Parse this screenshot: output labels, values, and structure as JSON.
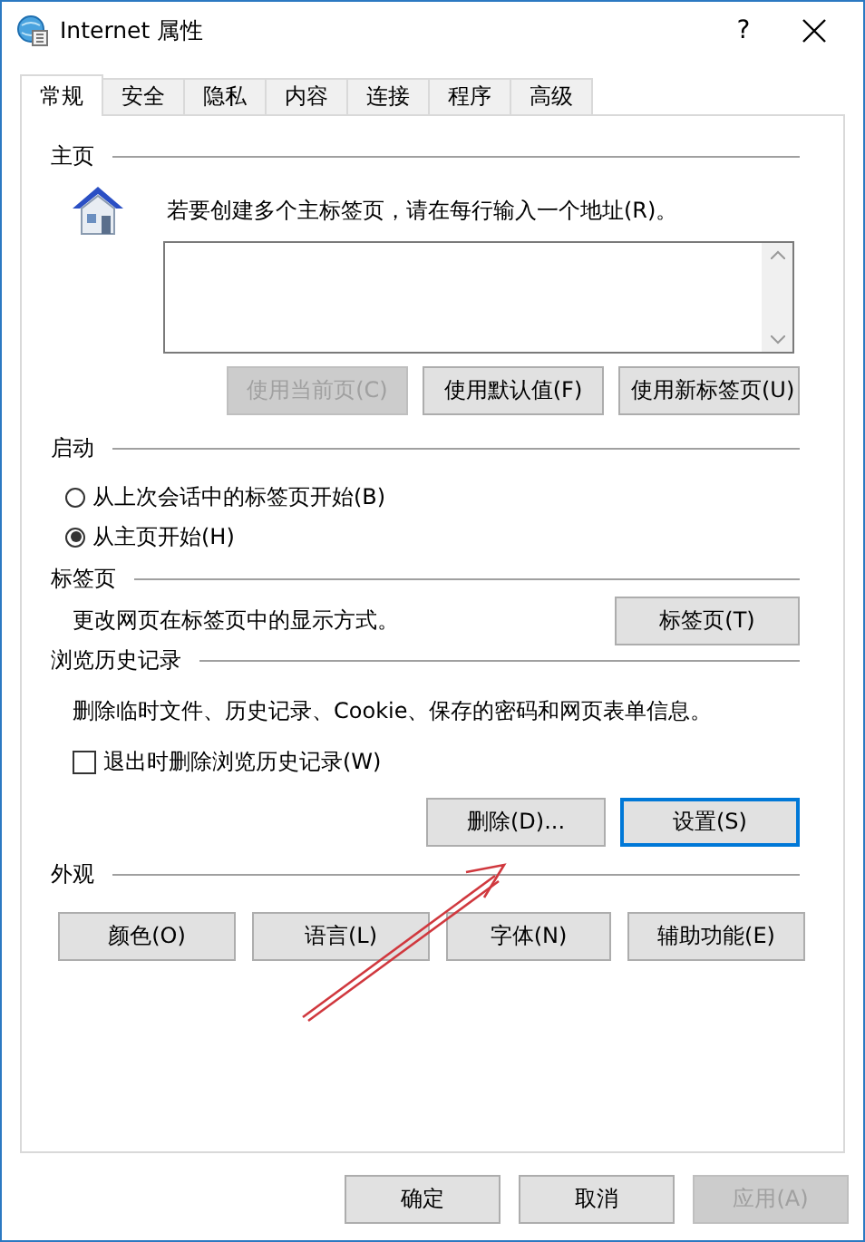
{
  "window": {
    "title": "Internet 属性",
    "help": "?"
  },
  "tabs": [
    {
      "label": "常规",
      "selected": true
    },
    {
      "label": "安全",
      "selected": false
    },
    {
      "label": "隐私",
      "selected": false
    },
    {
      "label": "内容",
      "selected": false
    },
    {
      "label": "连接",
      "selected": false
    },
    {
      "label": "程序",
      "selected": false
    },
    {
      "label": "高级",
      "selected": false
    }
  ],
  "homepage": {
    "heading": "主页",
    "hint": "若要创建多个主标签页，请在每行输入一个地址(R)。",
    "buttons": [
      {
        "label": "使用当前页(C)",
        "disabled": true
      },
      {
        "label": "使用默认值(F)",
        "disabled": false
      },
      {
        "label": "使用新标签页(U)",
        "disabled": false
      }
    ]
  },
  "startup": {
    "heading": "启动",
    "options": [
      {
        "label": "从上次会话中的标签页开始(B)",
        "selected": false
      },
      {
        "label": "从主页开始(H)",
        "selected": true
      }
    ]
  },
  "tab_settings": {
    "heading": "标签页",
    "description": "更改网页在标签页中的显示方式。",
    "button": "标签页(T)"
  },
  "history": {
    "heading": "浏览历史记录",
    "description": "删除临时文件、历史记录、Cookie、保存的密码和网页表单信息。",
    "checkbox": {
      "label": "退出时删除浏览历史记录(W)",
      "checked": false
    },
    "buttons": [
      {
        "label": "删除(D)...",
        "focused": false
      },
      {
        "label": "设置(S)",
        "focused": true
      }
    ]
  },
  "appearance": {
    "heading": "外观",
    "buttons": [
      "颜色(O)",
      "语言(L)",
      "字体(N)",
      "辅助功能(E)"
    ]
  },
  "footer": [
    {
      "label": "确定",
      "disabled": false
    },
    {
      "label": "取消",
      "disabled": false
    },
    {
      "label": "应用(A)",
      "disabled": true
    }
  ]
}
